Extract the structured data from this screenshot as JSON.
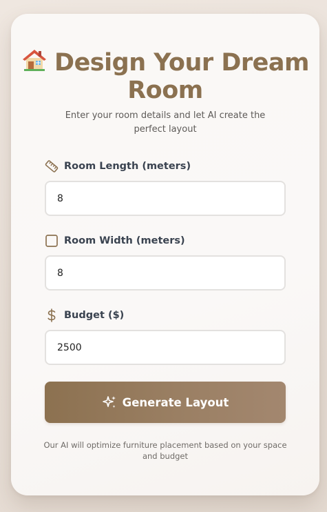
{
  "header": {
    "title": "Design Your Dream Room",
    "subtitle": "Enter your room details and let AI create the perfect layout"
  },
  "form": {
    "length": {
      "icon": "ruler-icon",
      "label": "Room Length (meters)",
      "value": "8"
    },
    "width": {
      "icon": "square-icon",
      "label": "Room Width (meters)",
      "value": "8"
    },
    "budget": {
      "icon": "dollar-icon",
      "label": "Budget ($)",
      "value": "2500"
    },
    "submit": {
      "icon": "sparkles-icon",
      "label": "Generate Layout"
    }
  },
  "footer": {
    "note": "Our AI will optimize furniture placement based on your space and budget"
  },
  "colors": {
    "accent": "#8b7150",
    "button_start": "#8c7150",
    "button_end": "#a3876f",
    "label_text": "#3a4350"
  }
}
